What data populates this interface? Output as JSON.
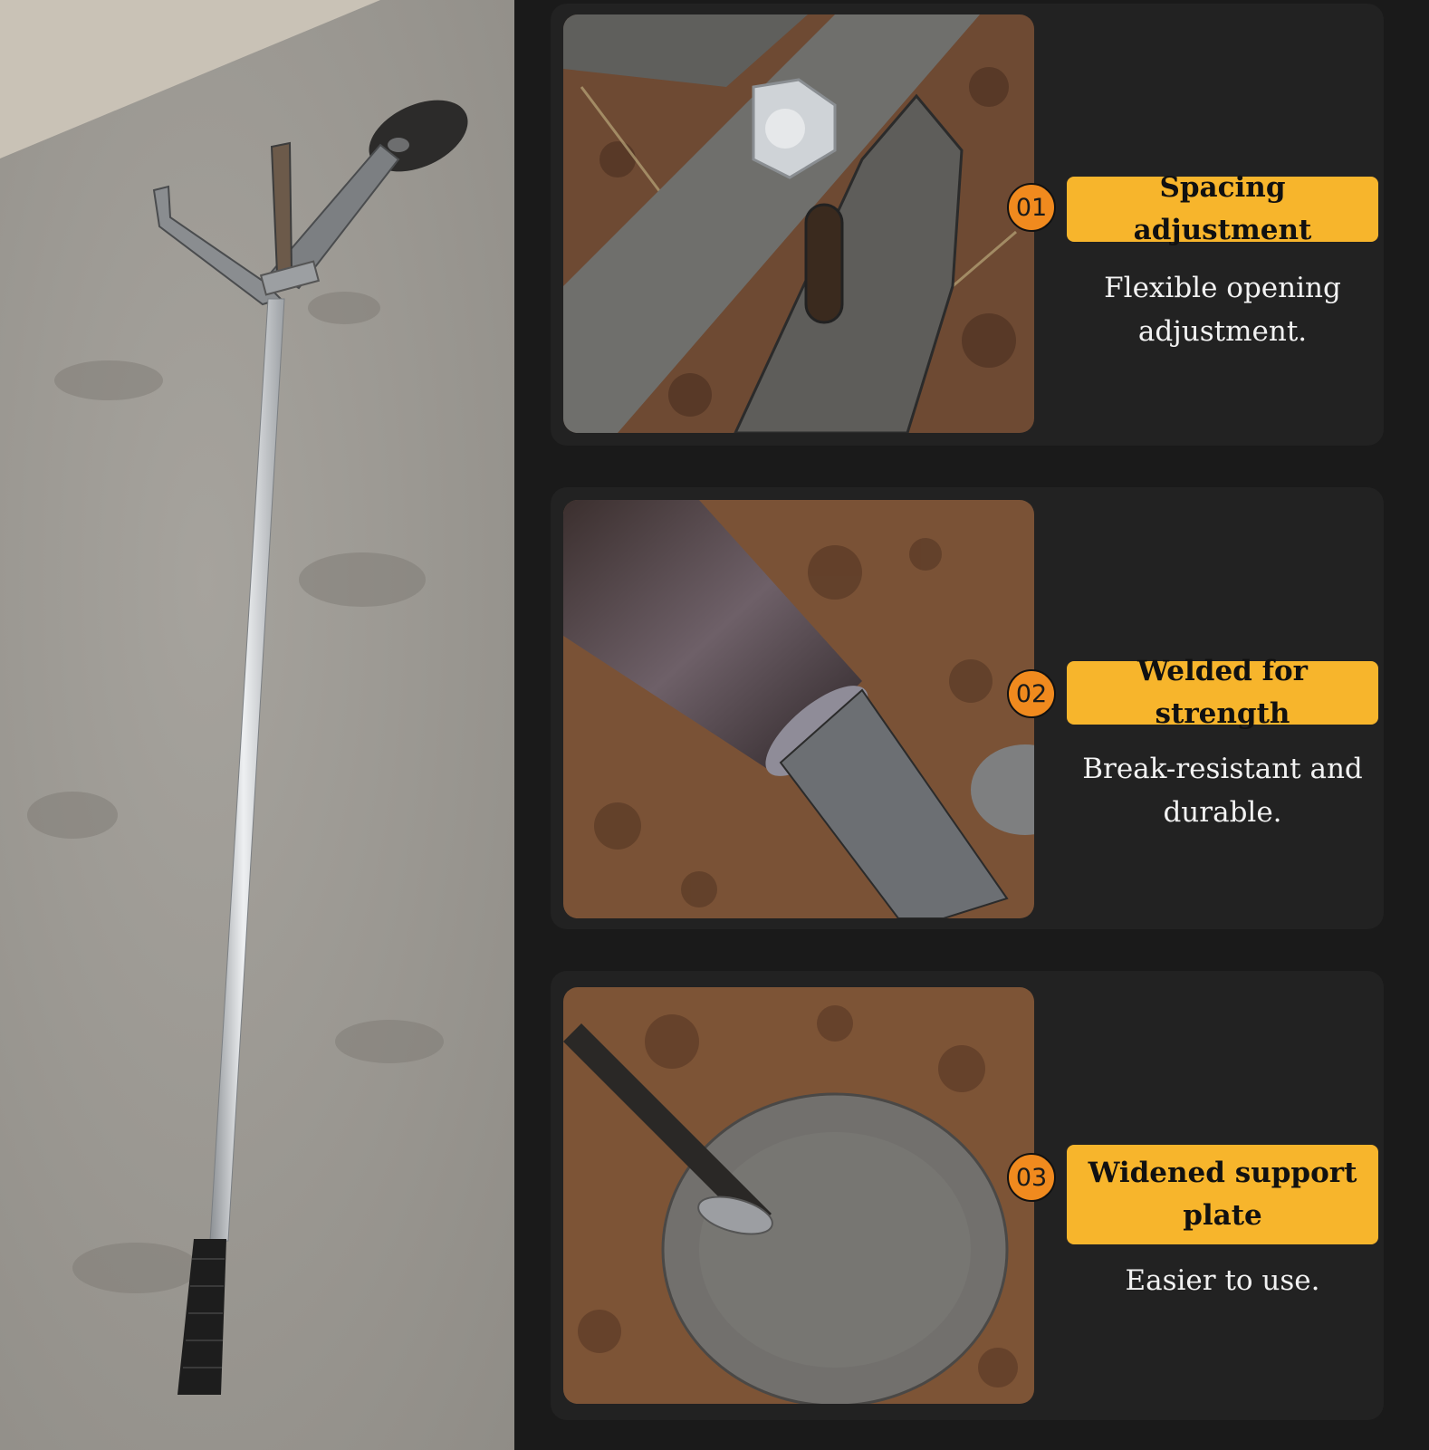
{
  "features": [
    {
      "number": "01",
      "title": "Spacing adjustment",
      "description": "Flexible opening adjustment."
    },
    {
      "number": "02",
      "title": "Welded for strength",
      "description": "Break-resistant and durable."
    },
    {
      "number": "03",
      "title": "Widened support plate",
      "description": "Easier to use."
    }
  ],
  "colors": {
    "accent_badge": "#f08a1e",
    "title_background": "#f7b52c",
    "panel_background": "#1a1a1a",
    "card_background": "#222222"
  }
}
